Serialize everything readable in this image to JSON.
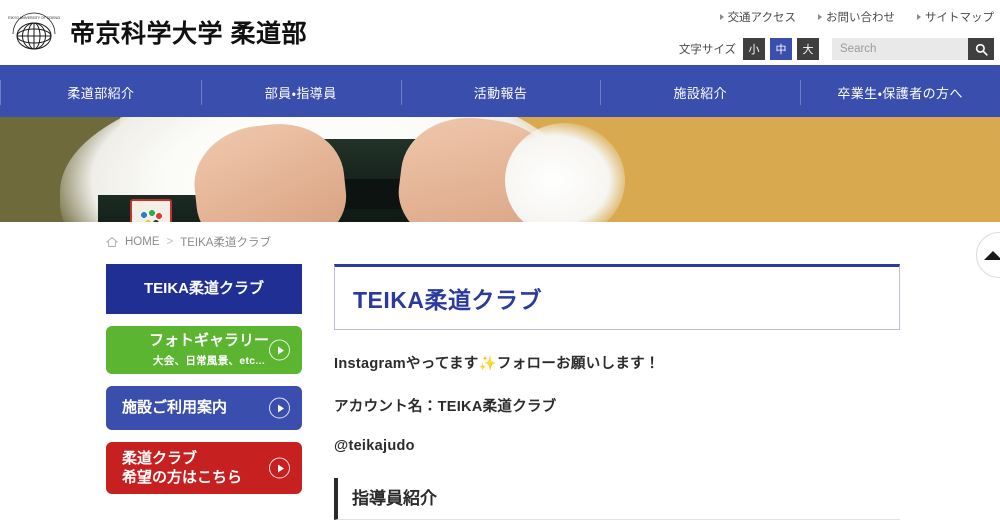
{
  "header": {
    "logo_alt": "帝京科学大学ロゴ",
    "title": "帝京科学大学 柔道部",
    "util_links": [
      {
        "label": "交通アクセス"
      },
      {
        "label": "お問い合わせ"
      },
      {
        "label": "サイトマップ"
      }
    ],
    "fontsize": {
      "label": "文字サイズ",
      "options": [
        {
          "label": "小",
          "active": false
        },
        {
          "label": "中",
          "active": true
        },
        {
          "label": "大",
          "active": false
        }
      ]
    },
    "search": {
      "placeholder": "Search",
      "value": "",
      "button_label": "検索"
    }
  },
  "nav": {
    "items": [
      {
        "label": "柔道部紹介"
      },
      {
        "label": "部員・指導員"
      },
      {
        "label": "活動報告"
      },
      {
        "label": "施設紹介"
      },
      {
        "label": "卒業生・保護者の方へ"
      }
    ]
  },
  "breadcrumb": {
    "home_label": "HOME",
    "separator": ">",
    "current": "TEIKA柔道クラブ"
  },
  "sidebar": {
    "buttons": [
      {
        "title": "TEIKA柔道クラブ",
        "sub": "",
        "style": "current",
        "arrow": false
      },
      {
        "title": "フォトギャラリー",
        "sub": "大会、日常風景、etc...",
        "style": "green",
        "arrow": true
      },
      {
        "title": "施設ご利用案内",
        "sub": "",
        "style": "blue",
        "arrow": true
      },
      {
        "title": "柔道クラブ\n希望の方はこちら",
        "sub": "",
        "style": "red",
        "arrow": true
      }
    ]
  },
  "main": {
    "page_title": "TEIKA柔道クラブ",
    "paragraphs": [
      {
        "pre": "Instagramやってます",
        "sparkle": "✨",
        "post": "フォローお願いします！"
      },
      {
        "pre": "アカウント名：TEIKA柔道クラブ",
        "sparkle": "",
        "post": ""
      },
      {
        "pre": "@teikajudo",
        "sparkle": "",
        "post": ""
      }
    ],
    "section_heading": "指導員紹介"
  },
  "scroll_top": {
    "label": "ページトップへ戻る"
  },
  "colors": {
    "nav_blue": "#3a4ead",
    "active_navy": "#1f2f94",
    "green": "#5cb531",
    "red": "#c62020",
    "title_blue": "#2b3a9e"
  }
}
